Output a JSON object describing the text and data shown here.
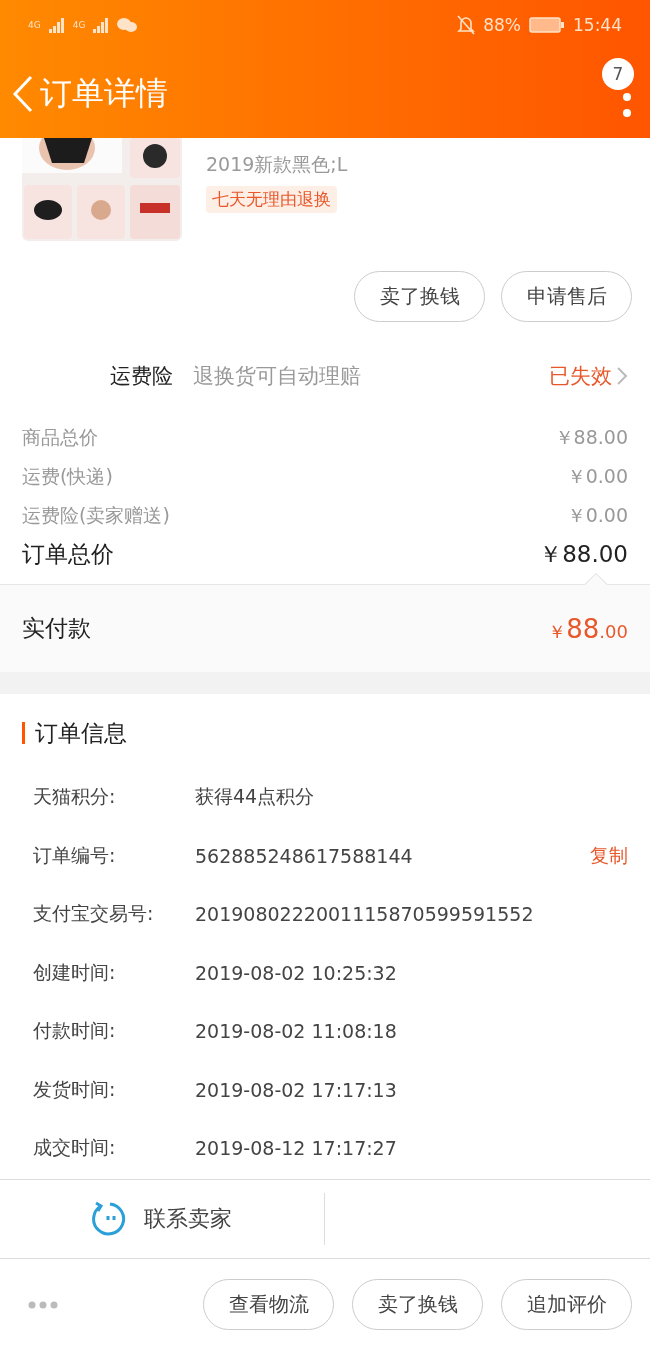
{
  "status_bar": {
    "network": [
      "4G",
      "4G"
    ],
    "battery": "88%",
    "time": "15:44",
    "muted": true
  },
  "nav": {
    "title": "订单详情",
    "badge": "7"
  },
  "product": {
    "kind": "picture",
    "sku": "2019新款黑色;L",
    "tag": "七天无理由退换"
  },
  "item_actions": [
    "卖了换钱",
    "申请售后"
  ],
  "insurance": {
    "label": "运费险",
    "desc": "退换货可自动理赔",
    "status": "已失效"
  },
  "prices": [
    {
      "label": "商品总价",
      "value": "￥88.00"
    },
    {
      "label": "运费(快递)",
      "value": "￥0.00"
    },
    {
      "label": "运费险(卖家赠送)",
      "value": "￥0.00"
    }
  ],
  "order_total": {
    "label": "订单总价",
    "value": "￥88.00"
  },
  "paid": {
    "label": "实付款",
    "symbol": "￥",
    "integer": "88",
    "decimal": ".00"
  },
  "order_info": {
    "title": "订单信息",
    "rows": [
      {
        "label": "天猫积分:",
        "value": "获得44点积分"
      },
      {
        "label": "订单编号:",
        "value": "562885248617588144",
        "action": "复制"
      },
      {
        "label": "支付宝交易号:",
        "value": "2019080222001115870599591552"
      },
      {
        "label": "创建时间:",
        "value": "2019-08-02 10:25:32"
      },
      {
        "label": "付款时间:",
        "value": "2019-08-02 11:08:18"
      },
      {
        "label": "发货时间:",
        "value": "2019-08-02 17:17:13"
      },
      {
        "label": "成交时间:",
        "value": "2019-08-12 17:17:27"
      }
    ]
  },
  "contact": {
    "label": "联系卖家"
  },
  "bottom_actions": [
    "查看物流",
    "卖了换钱",
    "追加评价"
  ]
}
